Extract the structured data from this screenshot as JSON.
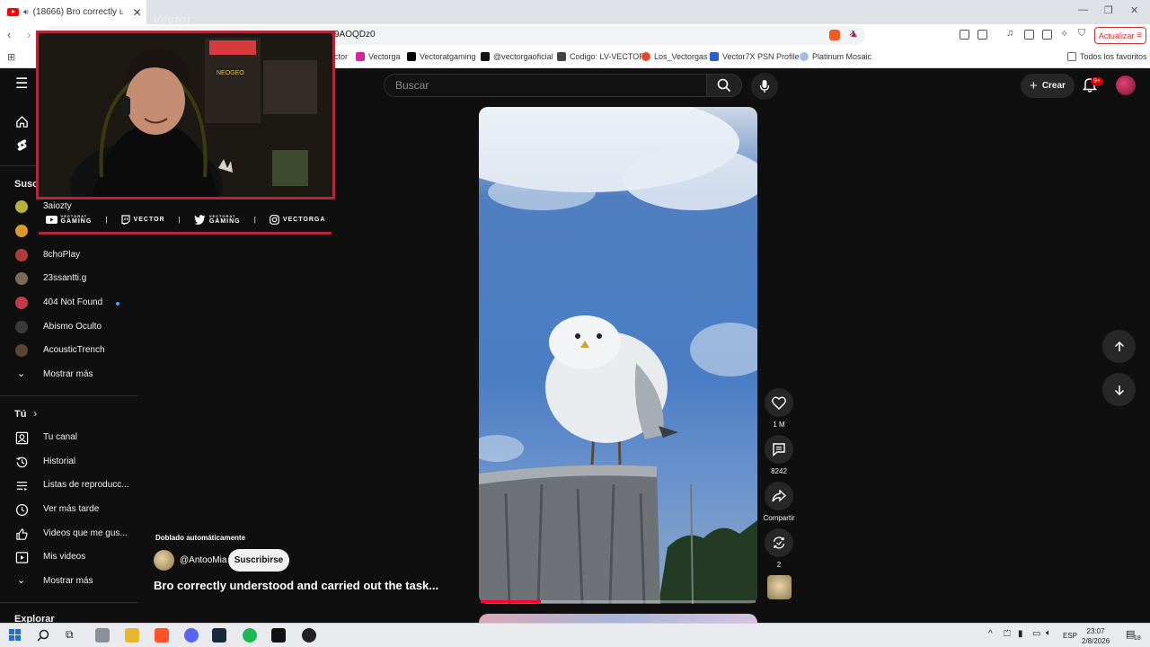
{
  "browser": {
    "tab_title": "(18666) Bro correctly underst",
    "url": "9AOQDz0",
    "update_label": "Actualizar",
    "bookmarks": [
      "ctor",
      "Vectorga",
      "Vectoratgaming",
      "@vectorgaoficial",
      "Codigo: LV-VECTOR",
      "Los_Vectorgas",
      "Vector7X PSN Profile",
      "Platinum Mosaic"
    ],
    "favorites_label": "Todos los favoritos"
  },
  "header": {
    "search_placeholder": "Buscar",
    "create_label": "Crear",
    "notif_count": "9+"
  },
  "sidebar": {
    "subs_title": "Susc",
    "subscriptions": [
      {
        "name": "3aiozty",
        "color": "#b7b33a"
      },
      {
        "name": "",
        "color": "#d89a2c"
      },
      {
        "name": "8choPlay",
        "color": "#b33a3a"
      },
      {
        "name": "23ssantti.g",
        "color": "#7a6a52"
      },
      {
        "name": "404 Not Found",
        "color": "#c2394a"
      },
      {
        "name": "Abismo Oculto",
        "color": "#3a3a3a"
      },
      {
        "name": "AcousticTrench",
        "color": "#5a4632"
      }
    ],
    "show_more": "Mostrar más",
    "you_title": "Tú",
    "you_items": [
      "Tu canal",
      "Historial",
      "Listas de reproducc...",
      "Ver más tarde",
      "Videos que me gus...",
      "Mis videos",
      "Mostrar más"
    ],
    "explore_title": "Explorar"
  },
  "overlay": {
    "logo": "Vector",
    "socials": [
      "GAMING",
      "VECTOR",
      "GAMING",
      "VECTORGA"
    ],
    "socials_top": [
      "VECTORAT",
      "",
      "VECTORAT",
      ""
    ]
  },
  "short": {
    "dub_label": "Doblado automáticamente",
    "channel": "@AntooMia",
    "subscribe_label": "Suscribirse",
    "title": "Bro correctly understood and carried out the task...",
    "likes": "1 M",
    "comments": "8242",
    "share_label": "Compartir",
    "remix_count": "2",
    "progress": 0.22
  },
  "taskbar": {
    "lang": "ESP",
    "time": "23:07",
    "date": "2/8/2026",
    "notif_count": "18"
  }
}
